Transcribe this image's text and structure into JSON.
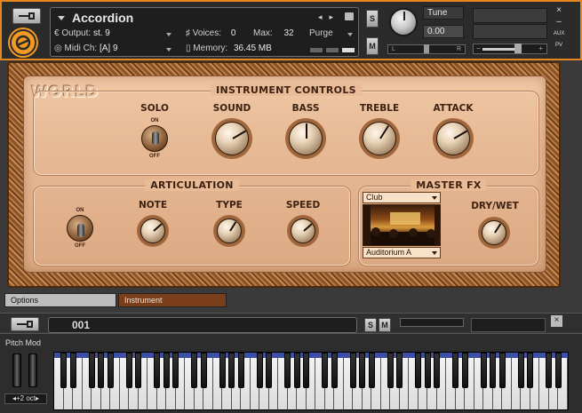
{
  "header": {
    "instrument_name": "Accordion",
    "output_label": "Output:",
    "output_value": "st. 9",
    "voices_label": "Voices:",
    "voices_value": "0",
    "max_label": "Max:",
    "max_value": "32",
    "purge_label": "Purge",
    "midi_label": "Midi Ch:",
    "midi_value": "[A]  9",
    "memory_label": "Memory:",
    "memory_value": "36.45 MB",
    "solo_btn": "S",
    "mute_btn": "M",
    "tune_label": "Tune",
    "tune_value": "0.00",
    "pan_left": "L",
    "pan_right": "R",
    "vol_minus": "−",
    "vol_plus": "+",
    "close": "×",
    "minimize": "–",
    "aux": "AUX",
    "pv": "PV"
  },
  "panel": {
    "logo": "WORLD",
    "instrument_controls": {
      "title": "INSTRUMENT CONTROLS",
      "solo": "SOLO",
      "solo_on": "ON",
      "solo_off": "OFF",
      "sound": "SOUND",
      "bass": "BASS",
      "treble": "TREBLE",
      "attack": "ATTACK",
      "knob_levels": {
        "sound": 0.72,
        "bass": 0.5,
        "treble": 0.62,
        "attack": 0.72
      }
    },
    "articulation": {
      "title": "ARTICULATION",
      "on": "ON",
      "off": "OFF",
      "note": "NOTE",
      "type": "TYPE",
      "speed": "SPEED",
      "knob_levels": {
        "note": 0.68,
        "type": 0.62,
        "speed": 0.68
      }
    },
    "master_fx": {
      "title": "MASTER FX",
      "room_type": "Club",
      "room_preset": "Auditorium A",
      "dry_wet": "DRY/WET",
      "dry_wet_level": 0.62
    }
  },
  "tabs": {
    "options": "Options",
    "instrument": "Instrument"
  },
  "rack2": {
    "preset": "001",
    "solo": "S",
    "mute": "M",
    "close": "×"
  },
  "keyboard": {
    "pitch_mod": "Pitch Mod",
    "octave": "◂+2 oct▸"
  },
  "colors": {
    "accent": "#e8861e",
    "wood": "#e6b894",
    "tab_active": "#7a3f1a"
  }
}
